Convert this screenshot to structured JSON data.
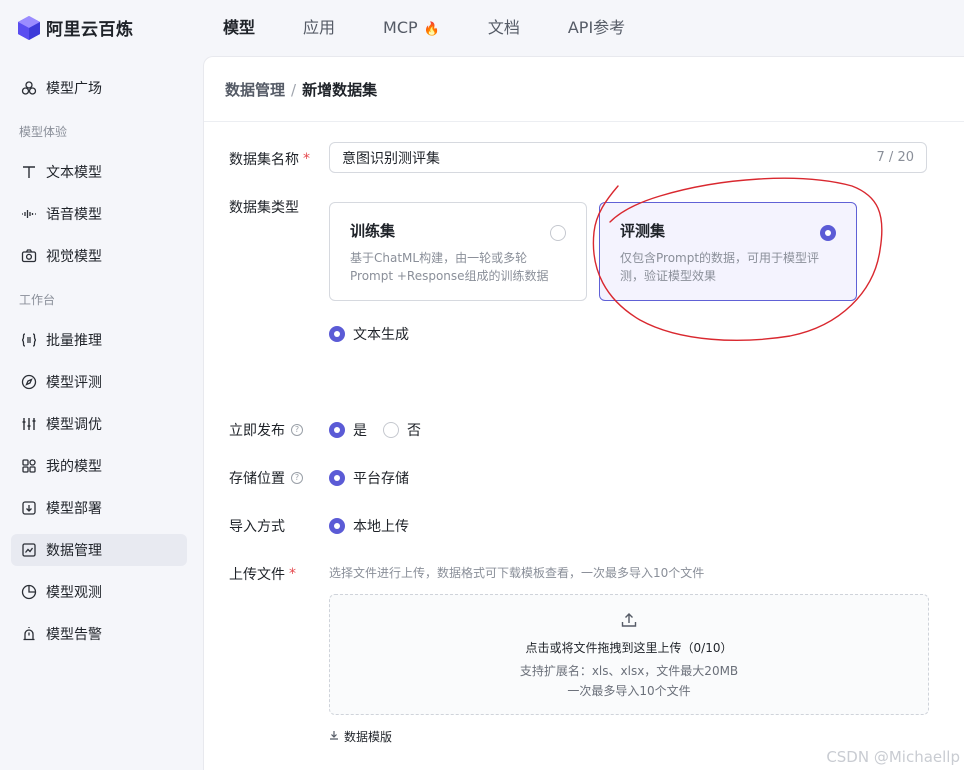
{
  "brand": {
    "name": "阿里云百炼"
  },
  "top_nav": [
    {
      "label": "模型",
      "active": true
    },
    {
      "label": "应用"
    },
    {
      "label": "MCP",
      "badge_icon": "flame-icon"
    },
    {
      "label": "文档"
    },
    {
      "label": "API参考"
    }
  ],
  "sidebar": {
    "items": [
      {
        "label": "模型广场",
        "icon": "cloud-nodes-icon"
      },
      {
        "label": "文本模型",
        "icon": "text-icon"
      },
      {
        "label": "语音模型",
        "icon": "waveform-icon"
      },
      {
        "label": "视觉模型",
        "icon": "camera-icon"
      },
      {
        "label": "批量推理",
        "icon": "braces-list-icon"
      },
      {
        "label": "模型评测",
        "icon": "compass-icon"
      },
      {
        "label": "模型调优",
        "icon": "sliders-icon"
      },
      {
        "label": "我的模型",
        "icon": "grid-icon"
      },
      {
        "label": "模型部署",
        "icon": "deploy-box-icon"
      },
      {
        "label": "数据管理",
        "icon": "chart-line-icon",
        "active": true
      },
      {
        "label": "模型观测",
        "icon": "pie-icon"
      },
      {
        "label": "模型告警",
        "icon": "alarm-icon"
      }
    ],
    "sections": [
      "模型体验",
      "工作台"
    ]
  },
  "breadcrumb": {
    "parent": "数据管理",
    "separator": "/",
    "current": "新增数据集"
  },
  "form": {
    "name": {
      "label": "数据集名称",
      "value": "意图识别测评集",
      "count": "7 / 20"
    },
    "type": {
      "label": "数据集类型",
      "cards": [
        {
          "title": "训练集",
          "desc": "基于ChatML构建，由一轮或多轮Prompt +Response组成的训练数据",
          "selected": false
        },
        {
          "title": "评测集",
          "desc": "仅包含Prompt的数据，可用于模型评测，验证模型效果",
          "selected": true
        }
      ],
      "subtype": "文本生成"
    },
    "publish": {
      "label": "立即发布",
      "yes": "是",
      "no": "否"
    },
    "storage": {
      "label": "存储位置",
      "option": "平台存储"
    },
    "import": {
      "label": "导入方式",
      "option": "本地上传"
    },
    "upload": {
      "label": "上传文件",
      "hint": "选择文件进行上传，数据格式可下载模板查看，一次最多导入10个文件",
      "drop_main": "点击或将文件拖拽到这里上传（0/10）",
      "drop_ext": "支持扩展名：xls、xlsx，文件最大20MB",
      "drop_limit": "一次最多导入10个文件",
      "template_link": "数据模版"
    }
  },
  "watermark": "CSDN @Michaellp",
  "colors": {
    "accent": "#5b5bd6",
    "required": "#e5484d",
    "annotation": "#d9282f"
  }
}
